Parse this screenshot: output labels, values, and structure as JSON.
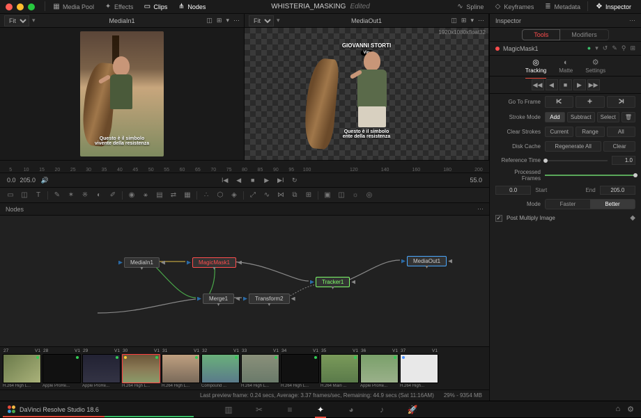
{
  "project": {
    "name": "WHISTERIA_MASKING",
    "status": "Edited"
  },
  "titlebar": {
    "tools": [
      {
        "name": "media-pool",
        "label": "Media Pool",
        "icon": "▦"
      },
      {
        "name": "effects",
        "label": "Effects",
        "icon": "✦"
      },
      {
        "name": "clips",
        "label": "Clips",
        "icon": "▭",
        "active": true
      },
      {
        "name": "nodes-tb",
        "label": "Nodes",
        "icon": "⋔",
        "active": true
      }
    ],
    "right": [
      {
        "name": "spline",
        "label": "Spline",
        "icon": "∿"
      },
      {
        "name": "keyframes",
        "label": "Keyframes",
        "icon": "◇"
      },
      {
        "name": "metadata",
        "label": "Metadata",
        "icon": "≣"
      },
      {
        "name": "inspector",
        "label": "Inspector",
        "icon": "✥",
        "active": true
      }
    ]
  },
  "viewers": {
    "left": {
      "fit": "Fit",
      "name": "MediaIn1",
      "caption": "Questo è il simbolo\nvivente della resistenza"
    },
    "right": {
      "fit": "Fit",
      "name": "MediaOut1",
      "info": "1920x1080xfloat32",
      "title_top": "GIOVANNI STORTI",
      "vip": "Vip",
      "caption": "Questo è il simbolo\nente della resistenza"
    }
  },
  "ruler": [
    "5",
    "10",
    "15",
    "20",
    "25",
    "30",
    "35",
    "40",
    "45",
    "50",
    "55",
    "60",
    "65",
    "70",
    "75",
    "80",
    "85",
    "90",
    "95",
    "100",
    "",
    "",
    "120",
    "",
    "140",
    "",
    "160",
    "",
    "180",
    "",
    "200"
  ],
  "transport": {
    "start": "0.0",
    "end": "205.0",
    "current": "55.0",
    "volume_icon": "🔊"
  },
  "nodes_panel": {
    "label": "Nodes"
  },
  "nodes": {
    "media_in": "MediaIn1",
    "magic_mask": "MagicMask1",
    "merge": "Merge1",
    "transform": "Transform2",
    "tracker": "Tracker1",
    "media_out": "MediaOut1"
  },
  "clips": [
    {
      "n": "27",
      "v": "V1",
      "fmt": "H.264 High L...",
      "dr": "#33cc55",
      "dl": "",
      "bg": "linear-gradient(140deg,#6a7a4a,#aab27a)"
    },
    {
      "n": "28",
      "v": "V1",
      "fmt": "Apple ProRe...",
      "dr": "#33cc55",
      "dl": "",
      "bg": "#111"
    },
    {
      "n": "29",
      "v": "V1",
      "fmt": "Apple ProRe...",
      "dr": "#33cc55",
      "dl": "",
      "bg": "linear-gradient(#223,#334)"
    },
    {
      "n": "30",
      "v": "V1",
      "fmt": "H.264 High L...",
      "dr": "#33cc55",
      "dl": "#ffcc33",
      "sel": true,
      "bg": "linear-gradient(180deg,#6a5538,#8a7a55,#8a9a6a)"
    },
    {
      "n": "31",
      "v": "V1",
      "fmt": "H.264 High L...",
      "dr": "#33cc55",
      "dl": "",
      "bg": "linear-gradient(#bfa080,#7a6a5a)"
    },
    {
      "n": "32",
      "v": "V1",
      "fmt": "Compound ...",
      "dr": "#33cc55",
      "dl": "",
      "bg": "linear-gradient(#6ab07a,#5a7a8a)"
    },
    {
      "n": "33",
      "v": "V1",
      "fmt": "H.264 High L...",
      "dr": "#33cc55",
      "dl": "",
      "bg": "linear-gradient(#8a907a,#6a7a6a)"
    },
    {
      "n": "34",
      "v": "V1",
      "fmt": "H.264 High L...",
      "dr": "#33cc55",
      "dl": "",
      "bg": "#111"
    },
    {
      "n": "35",
      "v": "V1",
      "fmt": "H.264 Main ...",
      "dr": "#33cc55",
      "dl": "",
      "bg": "linear-gradient(#7a9a5a,#5a7a4a)"
    },
    {
      "n": "36",
      "v": "V1",
      "fmt": "Apple ProRe...",
      "dr": "#33cc55",
      "dl": "",
      "bg": "linear-gradient(#7aa06a,#9ab08a)"
    },
    {
      "n": "37",
      "v": "V1",
      "fmt": "H.264 High...",
      "dr": "",
      "dl": "#4a90ff",
      "bg": "#e8e8e8"
    }
  ],
  "status": {
    "preview": "Last preview frame: 0.24 secs, Average: 3.37 frames/sec, Remaining: 44.9 secs (Sat 11:16AM)",
    "gpu": "29% - 9354 MB"
  },
  "footer": {
    "brand": "DaVinci Resolve Studio 18.6"
  },
  "inspector": {
    "header": "Inspector",
    "tabs": {
      "tools": "Tools",
      "modifiers": "Modifiers"
    },
    "node_name": "MagicMask1",
    "subtabs": {
      "tracking": "Tracking",
      "matte": "Matte",
      "settings": "Settings"
    },
    "go_to_frame": "Go To Frame",
    "stroke_mode": {
      "label": "Stroke Mode",
      "add": "Add",
      "subtract": "Subtract",
      "select": "Select"
    },
    "clear_strokes": {
      "label": "Clear Strokes",
      "current": "Current",
      "range": "Range",
      "all": "All"
    },
    "disk_cache": {
      "label": "Disk Cache",
      "regen": "Regenerate All",
      "clear": "Clear"
    },
    "reference_time": {
      "label": "Reference Time",
      "value": "1.0"
    },
    "processed_frames": {
      "label": "Processed Frames"
    },
    "range": {
      "start_val": "0.0",
      "start_lbl": "Start",
      "end_lbl": "End",
      "end_val": "205.0"
    },
    "mode": {
      "label": "Mode",
      "faster": "Faster",
      "better": "Better"
    },
    "post_multiply": "Post Multiply Image"
  }
}
